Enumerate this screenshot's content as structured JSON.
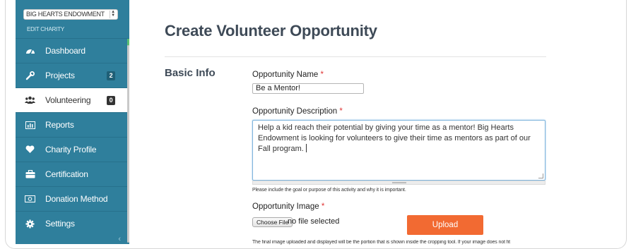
{
  "sidebar": {
    "charity_select": "BIG HEARTS ENDOWMENT",
    "edit_link": "EDIT CHARITY",
    "items": [
      {
        "label": "Dashboard",
        "icon": "tachometer-icon",
        "stripe": "#5bbf73",
        "badge": ""
      },
      {
        "label": "Projects",
        "icon": "wrench-icon",
        "stripe": "#f08a3a",
        "badge": "2"
      },
      {
        "label": "Volunteering",
        "icon": "group-icon",
        "stripe": "#3b8fbf",
        "badge": "0"
      },
      {
        "label": "Reports",
        "icon": "bar-chart-icon",
        "stripe": "#8e5fb5",
        "badge": ""
      },
      {
        "label": "Charity Profile",
        "icon": "heart-icon",
        "stripe": "#e04e6c",
        "badge": ""
      },
      {
        "label": "Certification",
        "icon": "briefcase-icon",
        "stripe": "#c28b3c",
        "badge": ""
      },
      {
        "label": "Donation Method",
        "icon": "money-icon",
        "stripe": "#2f7f9c",
        "badge": ""
      },
      {
        "label": "Settings",
        "icon": "gear-icon",
        "stripe": "#2f7f9c",
        "badge": ""
      }
    ],
    "active_index": 2,
    "collapse_glyph": "‹"
  },
  "main": {
    "title": "Create Volunteer Opportunity",
    "section": "Basic Info",
    "name_label": "Opportunity Name",
    "name_value": "Be a Mentor!",
    "desc_label": "Opportunity Description",
    "desc_value": "Help a kid reach their potential by giving your time as a mentor! Big Hearts Endowment is looking for volunteers to give their time as mentors as part of our Fall program.",
    "desc_help": "Please include the goal or purpose of this activity and why it is important.",
    "image_label": "Opportunity Image",
    "choose_file": "Choose File",
    "file_status": "no file selected",
    "upload": "Upload",
    "image_help": "The final image uploaded and displayed will be the portion that is shown inside the cropping tool. If your image does not fit",
    "required_mark": "*"
  },
  "colors": {
    "sidebar_bg": "#2f7f9c",
    "accent_orange": "#f26a32",
    "required": "#e03535"
  }
}
